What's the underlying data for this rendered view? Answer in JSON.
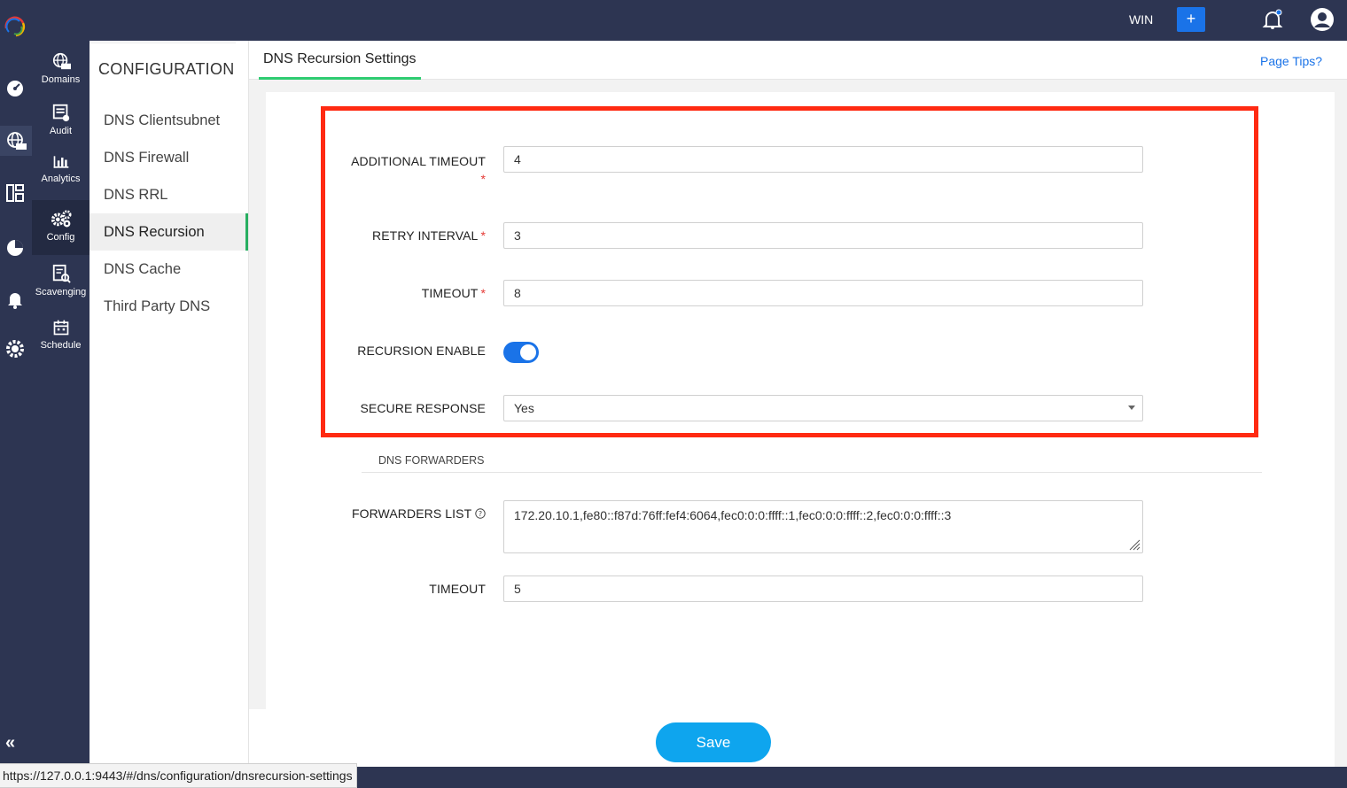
{
  "topbar": {
    "workspace": "WIN",
    "add_label": "+"
  },
  "nav2": {
    "items": [
      {
        "label": "Domains"
      },
      {
        "label": "Audit"
      },
      {
        "label": "Analytics"
      },
      {
        "label": "Config"
      },
      {
        "label": "Scavenging"
      },
      {
        "label": "Schedule"
      }
    ]
  },
  "config_menu": {
    "heading": "CONFIGURATION",
    "items": [
      {
        "label": "DNS Clientsubnet"
      },
      {
        "label": "DNS Firewall"
      },
      {
        "label": "DNS RRL"
      },
      {
        "label": "DNS Recursion"
      },
      {
        "label": "DNS Cache"
      },
      {
        "label": "Third Party DNS"
      }
    ]
  },
  "tabs": {
    "active_label": "DNS Recursion Settings",
    "page_tips": "Page Tips?"
  },
  "form": {
    "additional_timeout": {
      "label": "ADDITIONAL TIMEOUT",
      "required": "*",
      "value": "4"
    },
    "retry_interval": {
      "label": "RETRY INTERVAL",
      "required": "*",
      "value": "3"
    },
    "timeout": {
      "label": "TIMEOUT",
      "required": "*",
      "value": "8"
    },
    "recursion_enable": {
      "label": "RECURSION ENABLE",
      "on": true
    },
    "secure_response": {
      "label": "SECURE RESPONSE",
      "value": "Yes"
    },
    "forwarders_section": "DNS FORWARDERS",
    "forwarders_list": {
      "label": "FORWARDERS LIST",
      "value": "172.20.10.1,fe80::f87d:76ff:fef4:6064,fec0:0:0:ffff::1,fec0:0:0:ffff::2,fec0:0:0:ffff::3"
    },
    "forwarders_timeout": {
      "label": "TIMEOUT",
      "value": "5"
    }
  },
  "actions": {
    "save": "Save"
  },
  "status_bar": {
    "url": "https://127.0.0.1:9443/#/dns/configuration/dnsrecursion-settings"
  },
  "colors": {
    "accent": "#1a73e8",
    "save": "#0ea5ee",
    "nav_bg": "#2d3552",
    "highlight": "#ff2a12",
    "active_tab": "#2ecc71"
  }
}
